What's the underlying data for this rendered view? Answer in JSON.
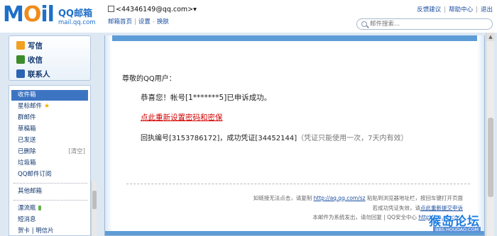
{
  "header": {
    "logo_text": "MOil",
    "brand": "QQ邮箱",
    "brand_domain": "mail.qq.com",
    "account": "<44346149@qq.com>",
    "account_caret": "▾",
    "sub_links": [
      "邮箱首页",
      "设置",
      "换肤"
    ],
    "top_links": [
      "反馈建议",
      "帮助中心",
      "退出"
    ],
    "search_placeholder": "邮件搜索..."
  },
  "sidebar": {
    "actions": [
      {
        "label": "写信",
        "icon": "pencil-icon"
      },
      {
        "label": "收信",
        "icon": "inbox-download-icon"
      },
      {
        "label": "联系人",
        "icon": "contacts-icon"
      }
    ],
    "folders": [
      {
        "label": "收件箱"
      },
      {
        "label": "星标邮件",
        "suffix": "★"
      },
      {
        "label": "群邮件"
      },
      {
        "label": "草稿箱"
      },
      {
        "label": "已发送"
      },
      {
        "label": "已删除",
        "extra": "[清空]"
      },
      {
        "label": "垃圾箱"
      },
      {
        "label": "QQ邮件订阅"
      }
    ],
    "extras": [
      "其他邮箱",
      "漂流瓶",
      "短消息",
      "贺卡 | 明信片"
    ]
  },
  "message": {
    "greeting": "尊敬的QQ用户：",
    "success": "恭喜您！帐号[1*******5]已申诉成功。",
    "reset_link": "点此重新设置密码和密保",
    "receipt": "回执编号[3153786172]，成功凭证[34452144]",
    "receipt_note": "（凭证只能使用一次，7天内有效）",
    "footer": {
      "line1_prefix": "如链接无法点击，请复制",
      "line1_link": "http://aq.qq.com/sz",
      "line1_suffix": "粘贴到浏览器地址栏，按回车键打开页面",
      "line2_prefix": "若成功凭证失效，请",
      "line2_link": "点此重新提交申诉",
      "line3_prefix": "本邮件为系统发出，请勿回复 | QQ安全中心",
      "line3_link": "http://aq.qq.com"
    }
  },
  "watermark": {
    "text": "猴岛论坛",
    "sub": "BBS.HOUDAO.COM"
  },
  "colors": {
    "brand_blue": "#1e6fc8",
    "link_red": "#d40000",
    "active_folder": "#3d74c2",
    "frame_bg": "#dde8f3"
  }
}
